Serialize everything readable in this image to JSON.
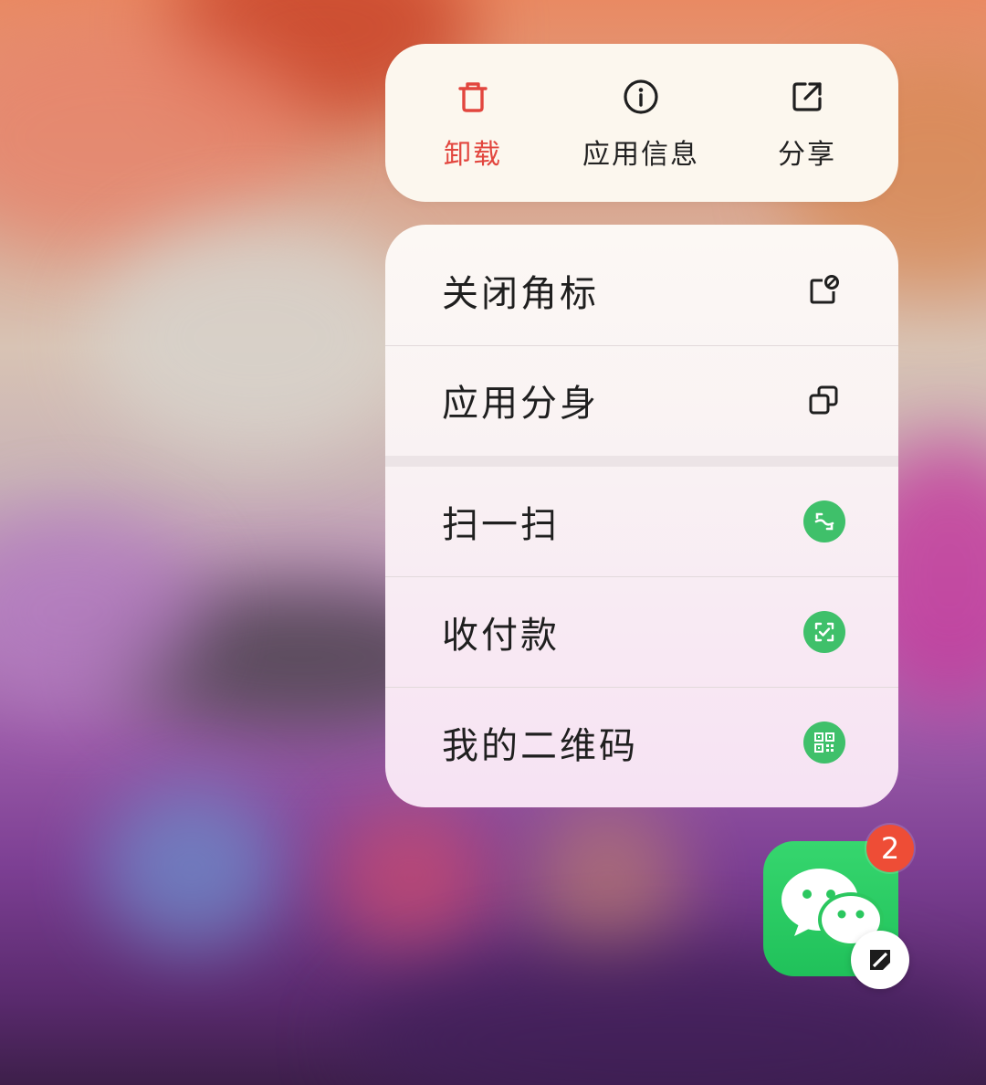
{
  "quick_actions": [
    {
      "label": "卸载",
      "icon": "trash-icon",
      "color": "#e2463e"
    },
    {
      "label": "应用信息",
      "icon": "info-circle-icon"
    },
    {
      "label": "分享",
      "icon": "share-arrow-icon"
    }
  ],
  "menu": {
    "items": [
      {
        "label": "关闭角标",
        "icon": "badge-off-icon"
      },
      {
        "label": "应用分身",
        "icon": "app-clone-icon"
      },
      {
        "label": "扫一扫",
        "icon": "scan-icon"
      },
      {
        "label": "收付款",
        "icon": "payment-scan-icon"
      },
      {
        "label": "我的二维码",
        "icon": "qr-code-icon"
      }
    ]
  },
  "app": {
    "name_icon": "wechat-app-icon",
    "badge_count": "2",
    "accent": "#2bc75f"
  }
}
